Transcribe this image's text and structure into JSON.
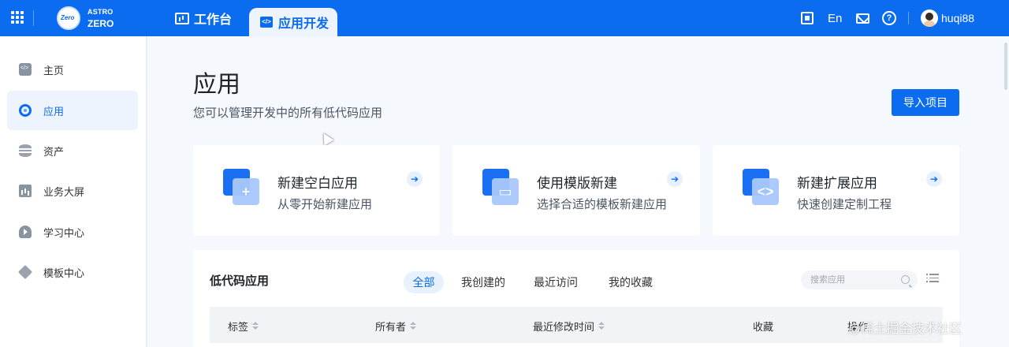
{
  "header": {
    "logo_top": "ASTRO",
    "logo_bottom": "ZERO",
    "logo_badge": "Zero",
    "tabs": [
      {
        "label": "工作台"
      },
      {
        "label": "应用开发"
      }
    ],
    "lang": "En",
    "help": "?",
    "username": "huqi88"
  },
  "sidebar": {
    "items": [
      {
        "label": "主页",
        "icon": "home-icon"
      },
      {
        "label": "应用",
        "icon": "app-icon",
        "active": true
      },
      {
        "label": "资产",
        "icon": "asset-icon"
      },
      {
        "label": "业务大屏",
        "icon": "dashboard-icon"
      },
      {
        "label": "学习中心",
        "icon": "learning-icon"
      },
      {
        "label": "模板中心",
        "icon": "template-icon"
      }
    ]
  },
  "main": {
    "title": "应用",
    "subtitle": "您可以管理开发中的所有低代码应用",
    "import_button": "导入项目",
    "cards": [
      {
        "title": "新建空白应用",
        "desc": "从零开始新建应用",
        "glyph": "+"
      },
      {
        "title": "使用模版新建",
        "desc": "选择合适的模板新建应用",
        "glyph": "▭"
      },
      {
        "title": "新建扩展应用",
        "desc": "快速创建定制工程",
        "glyph": "<>"
      }
    ],
    "card_arrow": "➔",
    "list": {
      "title": "低代码应用",
      "filters": [
        "全部",
        "我创建的",
        "最近访问",
        "我的收藏"
      ],
      "active_filter": "全部",
      "search_placeholder": "搜索应用",
      "columns": [
        "标签",
        "所有者",
        "最近修改时间",
        "收藏",
        "操作"
      ]
    }
  },
  "watermark": "@稀土掘金技术社区",
  "colors": {
    "primary": "#0b6cf0",
    "active_bg": "#eef4fd"
  }
}
